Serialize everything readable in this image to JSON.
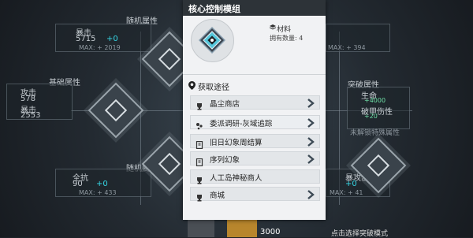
{
  "background": {
    "random_attr_top": "随机属性",
    "random_attr_bottom": "随机属性",
    "base_attr": "基础属性",
    "break_attr": "突破属性",
    "stat_top_left_name": "暴击",
    "stat_top_left_value": "5715",
    "stat_top_left_bonus": "+0",
    "stat_top_left_max": "MAX: + 2019",
    "stat_top_right_max": "MAX: + 394",
    "stat_left_1_name": "攻击",
    "stat_left_1_value": "578",
    "stat_left_2_name": "暴击",
    "stat_left_2_value": "2553",
    "stat_bottom_left_name": "全抗",
    "stat_bottom_left_value": "90",
    "stat_bottom_left_bonus": "+0",
    "stat_bottom_left_max": "MAX: + 433",
    "stat_bottom_right_name": "暴攻击",
    "stat_bottom_right_value": "+0",
    "stat_bottom_right_max": "MAX: + 41",
    "break_1": "生命",
    "break_1_value": "+4000",
    "break_2": "破甲伤性",
    "break_2_value": "+20",
    "break_note": "未解锁特殊属性",
    "bottom_center_value": "3000",
    "bottom_right_note": "点击选择突破模式"
  },
  "dialog": {
    "title": "核心控制模组",
    "item_type": "材料",
    "owned_label": "拥有数量: 4",
    "source_header": "获取途径",
    "sources": [
      {
        "label": "晶尘商店",
        "icon": "trophy-icon",
        "has_arrow": true
      },
      {
        "label": "委派调研-灰域追踪",
        "icon": "dots-icon",
        "has_arrow": true
      },
      {
        "label": "旧日幻象周结算",
        "icon": "book-icon",
        "has_arrow": true
      },
      {
        "label": "序列幻象",
        "icon": "book-icon",
        "has_arrow": true
      },
      {
        "label": "人工岛神秘商人",
        "icon": "trophy-icon",
        "has_arrow": false
      },
      {
        "label": "商城",
        "icon": "trophy-icon",
        "has_arrow": true
      }
    ]
  },
  "colors": {
    "dialog_bg": "#f1f2f4",
    "header_bg": "#2d3338",
    "accent_cyan": "#36d7e6"
  }
}
